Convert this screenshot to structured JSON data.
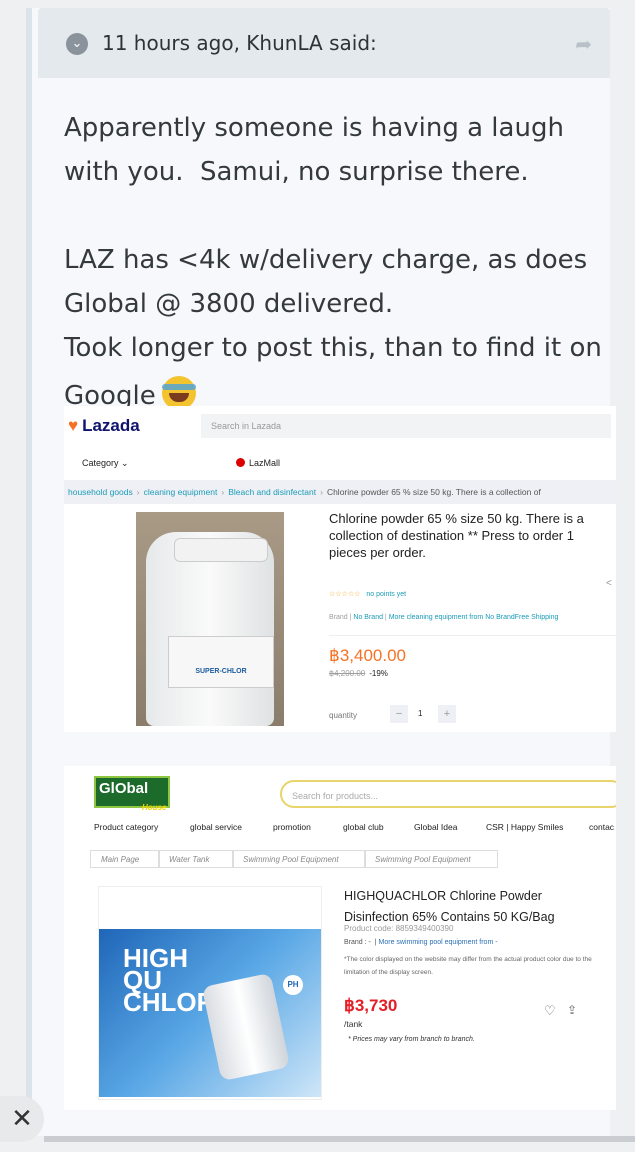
{
  "post": {
    "header": "11 hours ago, KhunLA said:",
    "text": "Apparently someone is having a laugh with you.  Samui, no surprise there.\n\nLAZ has <4k w/delivery charge, as does Global @ 3800 delivered.\nTook longer to post this, than to find it on Google"
  },
  "lazada": {
    "logo": "Lazada",
    "search_placeholder": "Search in Lazada",
    "category": "Category",
    "lazmall": "LazMall",
    "breadcrumb": [
      "household goods",
      "cleaning equipment",
      "Bleach and disinfectant",
      "Chlorine powder 65 % size 50 kg. There is a collection of"
    ],
    "product_label": "SUPER-CHLOR",
    "title": "Chlorine powder 65 % size 50 kg. There is a collection of destination ** Press to order 1 pieces per order.",
    "rating_text": "no points yet",
    "brand_label": "Brand",
    "brand_value": "No Brand",
    "brand_more": "More cleaning equipment from No BrandFree Shipping",
    "price": "฿3,400.00",
    "old_price": "฿4,200.00",
    "discount": "-19%",
    "quantity_label": "quantity",
    "quantity_value": "1",
    "minus": "−",
    "plus": "+"
  },
  "global": {
    "logo": "GlObal",
    "logo_sub": "House",
    "search_placeholder": "Search for products...",
    "nav": [
      "Product category",
      "global service",
      "promotion",
      "global club",
      "Global Idea",
      "CSR | Happy Smiles",
      "contac"
    ],
    "breadcrumbs": [
      "Main Page",
      "Water Tank",
      "Swimming Pool Equipment",
      "Swimming Pool Equipment"
    ],
    "poster_brand": "HIGH QU CHLOR",
    "ph_badge": "PH",
    "title": "HIGHQUACHLOR Chlorine Powder Disinfection 65% Contains 50 KG/Bag",
    "product_code": "Product code: 8859349400390",
    "brand_label": "Brand : -",
    "brand_more": "More swimming pool equipment from -",
    "note": "*The color displayed on the website may differ from the actual product color due to the limitation of the display screen.",
    "price": "฿3,730",
    "unit": "/tank",
    "fine_print": "* Prices may vary from branch to branch."
  },
  "ui": {
    "close_label": "✕",
    "chevron": "⌄",
    "share": "➦",
    "laz_share": "<"
  }
}
